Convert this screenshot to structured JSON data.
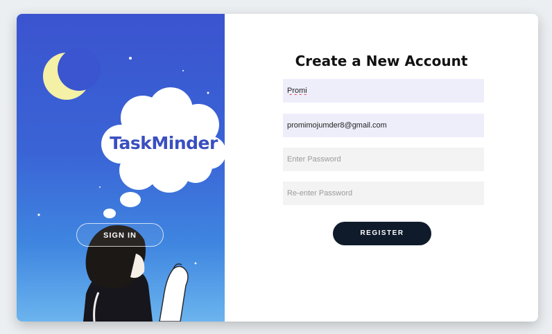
{
  "branding": {
    "app_name": "TaskMinder"
  },
  "left_panel": {
    "signin_label": "SIGN IN"
  },
  "form": {
    "title": "Create a New Account",
    "name_value": "Promi",
    "email_value": "promimojumder8@gmail.com",
    "password_placeholder": "Enter Password",
    "repassword_placeholder": "Re-enter Password",
    "register_label": "REGISTER"
  },
  "colors": {
    "panel_gradient_top": "#3b54cf",
    "panel_gradient_bottom": "#6bb4ee",
    "register_button": "#0f1b2b",
    "filled_field": "#eeeefb",
    "empty_field": "#f3f3f3"
  },
  "icons": [
    "crescent-moon-icon",
    "thought-cloud-icon",
    "girl-illustration"
  ]
}
